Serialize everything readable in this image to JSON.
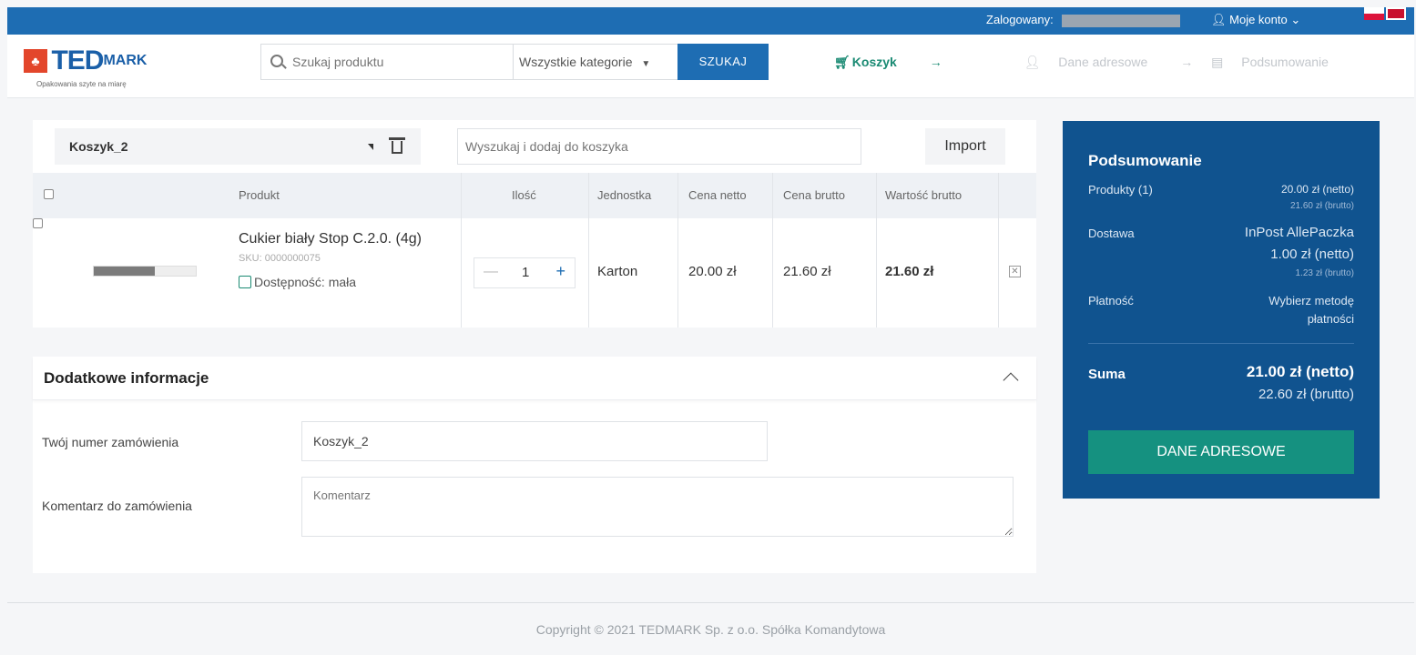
{
  "topbar": {
    "logged_label": "Zalogowany:",
    "account_label": "Moje konto",
    "account_icon": "user-icon",
    "account_chevron": "chevron-down-icon"
  },
  "header": {
    "logo_text": "TED",
    "logo_text2": "MARK",
    "logo_tagline": "Opakowania szyte na miarę",
    "search_placeholder": "Szukaj produktu",
    "categories_label": "Wszystkie kategorie",
    "search_button": "SZUKAJ",
    "steps": {
      "cart": "Koszyk",
      "address": "Dane adresowe",
      "summary": "Podsumowanie",
      "arrow": "→"
    }
  },
  "cart": {
    "selected_cart": "Koszyk_2",
    "add_search_placeholder": "Wyszukaj i dodaj do koszyka",
    "import_label": "Import",
    "columns": {
      "product": "Produkt",
      "quantity": "Ilość",
      "unit": "Jednostka",
      "net_price": "Cena netto",
      "gross_price": "Cena brutto",
      "gross_value": "Wartość brutto"
    },
    "items": [
      {
        "name": "Cukier biały Stop C.2.0. (4g)",
        "sku": "SKU: 0000000075",
        "availability": "Dostępność: mała",
        "quantity": "1",
        "unit": "Karton",
        "net_price": "20.00 zł",
        "gross_price": "21.60 zł",
        "gross_value": "21.60 zł"
      }
    ]
  },
  "extra_info": {
    "title": "Dodatkowe informacje",
    "order_number_label": "Twój numer zamówienia",
    "order_number_value": "Koszyk_2",
    "comment_label": "Komentarz do zamówienia",
    "comment_placeholder": "Komentarz"
  },
  "summary": {
    "title": "Podsumowanie",
    "products_label": "Produkty (1)",
    "products_net": "20.00 zł (netto)",
    "products_gross": "21.60 zł (brutto)",
    "delivery_label": "Dostawa",
    "delivery_method": "InPost AllePaczka",
    "delivery_net": "1.00 zł (netto)",
    "delivery_gross": "1.23 zł (brutto)",
    "payment_label": "Płatność",
    "payment_value": "Wybierz metodę płatności",
    "total_label": "Suma",
    "total_net": "21.00 zł (netto)",
    "total_gross": "22.60 zł (brutto)",
    "button": "DANE ADRESOWE"
  },
  "footer": {
    "copyright": "Copyright © 2021 TEDMARK Sp. z o.o. Spółka Komandytowa"
  },
  "colors": {
    "brand_blue": "#1e6db3",
    "summary_blue": "#10538f",
    "accent_green": "#159180",
    "logo_red": "#e3462b"
  }
}
